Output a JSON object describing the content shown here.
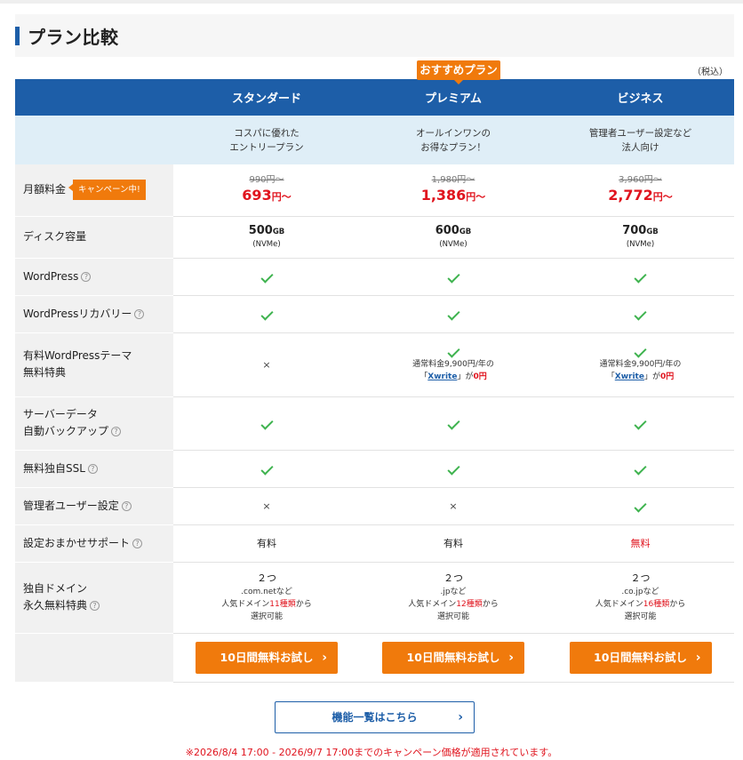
{
  "page": {
    "title": "プラン比較",
    "tax_note": "（税込）"
  },
  "recommend_label": "おすすめプラン",
  "plans": [
    {
      "name": "スタンダード",
      "desc1": "コスパに優れた",
      "desc2": "エントリープラン",
      "old_price": "990円〜",
      "price": "693",
      "price_unit": "円〜",
      "disk": "500",
      "disk_unit": "GB",
      "disk_type": "(NVMe)",
      "wordpress": "check",
      "wp_recovery": "check",
      "theme": "×",
      "backup": "check",
      "ssl": "check",
      "admin": "×",
      "support": "有料",
      "domain_count": "２つ",
      "domain_ext": ".com.netなど",
      "domain_pre": "人気ドメイン",
      "domain_num": "11種類",
      "domain_post": "から",
      "domain_sel": "選択可能",
      "cta": "10日間無料お試し"
    },
    {
      "name": "プレミアム",
      "desc1": "オールインワンの",
      "desc2": "お得なプラン！",
      "old_price": "1,980円〜",
      "price": "1,386",
      "price_unit": "円〜",
      "disk": "600",
      "disk_unit": "GB",
      "disk_type": "(NVMe)",
      "wordpress": "check",
      "wp_recovery": "check",
      "theme_line": "通常料金9,900円/年の",
      "theme_pre": "「",
      "theme_link": "Xwrite",
      "theme_mid": "」が",
      "theme_free": "0円",
      "backup": "check",
      "ssl": "check",
      "admin": "×",
      "support": "有料",
      "domain_count": "２つ",
      "domain_ext": ".jpなど",
      "domain_pre": "人気ドメイン",
      "domain_num": "12種類",
      "domain_post": "から",
      "domain_sel": "選択可能",
      "cta": "10日間無料お試し"
    },
    {
      "name": "ビジネス",
      "desc1": "管理者ユーザー設定など",
      "desc2": "法人向け",
      "old_price": "3,960円〜",
      "price": "2,772",
      "price_unit": "円〜",
      "disk": "700",
      "disk_unit": "GB",
      "disk_type": "(NVMe)",
      "wordpress": "check",
      "wp_recovery": "check",
      "theme_line": "通常料金9,900円/年の",
      "theme_pre": "「",
      "theme_link": "Xwrite",
      "theme_mid": "」が",
      "theme_free": "0円",
      "backup": "check",
      "ssl": "check",
      "admin": "check",
      "support": "無料",
      "domain_count": "２つ",
      "domain_ext": ".co.jpなど",
      "domain_pre": "人気ドメイン",
      "domain_num": "16種類",
      "domain_post": "から",
      "domain_sel": "選択可能",
      "cta": "10日間無料お試し"
    }
  ],
  "rows": {
    "monthly": "月額料金",
    "campaign_badge": "キャンペーン中!",
    "disk": "ディスク容量",
    "wordpress": "WordPress",
    "wp_recovery": "WordPressリカバリー",
    "theme_1": "有料WordPressテーマ",
    "theme_2": "無料特典",
    "backup_1": "サーバーデータ",
    "backup_2": "自動バックアップ",
    "ssl": "無料独自SSL",
    "admin": "管理者ユーザー設定",
    "support": "設定おまかせサポート",
    "domain_1": "独自ドメイン",
    "domain_2": "永久無料特典"
  },
  "help_glyph": "?",
  "chevron": "›",
  "features_button": "機能一覧はこちら",
  "campaign_note": "※2026/8/4 17:00 - 2026/9/7 17:00までのキャンペーン価格が適用されています。",
  "colors": {
    "brand_blue": "#1d5ea8",
    "accent_orange": "#f07a0c",
    "price_red": "#e0141e",
    "check_green": "#3fb34f"
  }
}
